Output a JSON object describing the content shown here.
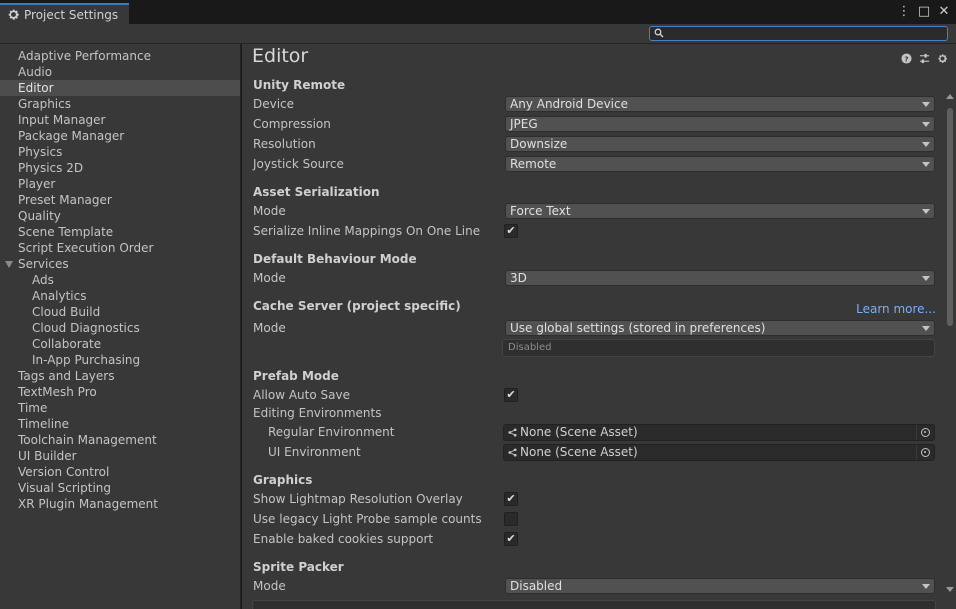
{
  "window": {
    "tab_title": "Project Settings",
    "controls": {
      "more": "⋮",
      "maximize": "□",
      "close": "✕"
    }
  },
  "search": {
    "placeholder": "",
    "icon": "search-icon"
  },
  "sidebar": {
    "items": [
      {
        "label": "Adaptive Performance",
        "selected": false
      },
      {
        "label": "Audio",
        "selected": false
      },
      {
        "label": "Editor",
        "selected": true
      },
      {
        "label": "Graphics",
        "selected": false
      },
      {
        "label": "Input Manager",
        "selected": false
      },
      {
        "label": "Package Manager",
        "selected": false
      },
      {
        "label": "Physics",
        "selected": false
      },
      {
        "label": "Physics 2D",
        "selected": false
      },
      {
        "label": "Player",
        "selected": false
      },
      {
        "label": "Preset Manager",
        "selected": false
      },
      {
        "label": "Quality",
        "selected": false
      },
      {
        "label": "Scene Template",
        "selected": false
      },
      {
        "label": "Script Execution Order",
        "selected": false
      }
    ],
    "services": {
      "label": "Services",
      "expanded": true,
      "children": [
        "Ads",
        "Analytics",
        "Cloud Build",
        "Cloud Diagnostics",
        "Collaborate",
        "In-App Purchasing"
      ]
    },
    "items_after": [
      "Tags and Layers",
      "TextMesh Pro",
      "Time",
      "Timeline",
      "Toolchain Management",
      "UI Builder",
      "Version Control",
      "Visual Scripting",
      "XR Plugin Management"
    ]
  },
  "main": {
    "title": "Editor",
    "header_icons": [
      "help-icon",
      "preset-icon",
      "settings-gear-icon"
    ],
    "unity_remote": {
      "heading": "Unity Remote",
      "device_label": "Device",
      "device_value": "Any Android Device",
      "compression_label": "Compression",
      "compression_value": "JPEG",
      "resolution_label": "Resolution",
      "resolution_value": "Downsize",
      "joystick_label": "Joystick Source",
      "joystick_value": "Remote"
    },
    "asset_serialization": {
      "heading": "Asset Serialization",
      "mode_label": "Mode",
      "mode_value": "Force Text",
      "inline_label": "Serialize Inline Mappings On One Line",
      "inline_checked": true
    },
    "default_behaviour": {
      "heading": "Default Behaviour Mode",
      "mode_label": "Mode",
      "mode_value": "3D"
    },
    "cache_server": {
      "heading": "Cache Server (project specific)",
      "learn_more": "Learn more...",
      "mode_label": "Mode",
      "mode_value": "Use global settings (stored in preferences)",
      "status": "Disabled"
    },
    "prefab_mode": {
      "heading": "Prefab Mode",
      "auto_save_label": "Allow Auto Save",
      "auto_save_checked": true,
      "editing_env_label": "Editing Environments",
      "regular_env_label": "Regular Environment",
      "regular_env_value": "None (Scene Asset)",
      "ui_env_label": "UI Environment",
      "ui_env_value": "None (Scene Asset)"
    },
    "graphics": {
      "heading": "Graphics",
      "lightmap_label": "Show Lightmap Resolution Overlay",
      "lightmap_checked": true,
      "legacy_probe_label": "Use legacy Light Probe sample counts",
      "legacy_probe_checked": false,
      "cookies_label": "Enable baked cookies support",
      "cookies_checked": true
    },
    "sprite_packer": {
      "heading": "Sprite Packer",
      "mode_label": "Mode",
      "mode_value": "Disabled"
    }
  },
  "colors": {
    "accent_tab": "#3a79bb",
    "link": "#7aaff5",
    "search_border": "#4a7fc1"
  },
  "check_glyph": "✔"
}
